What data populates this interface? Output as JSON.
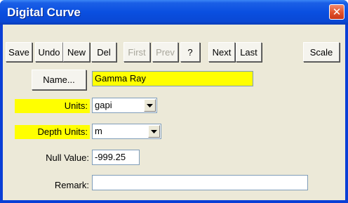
{
  "window": {
    "title": "Digital Curve",
    "close_glyph": "✕"
  },
  "toolbar": {
    "save": "Save",
    "undo": "Undo",
    "new": "New",
    "del": "Del",
    "first": "First",
    "prev": "Prev",
    "help": "?",
    "next": "Next",
    "last": "Last",
    "scale": "Scale"
  },
  "form": {
    "name_button": "Name...",
    "name_value": "Gamma Ray",
    "units_label": "Units:",
    "units_value": "gapi",
    "depth_units_label": "Depth Units:",
    "depth_units_value": "m",
    "null_label": "Null Value:",
    "null_value": "-999.25",
    "remark_label": "Remark:",
    "remark_value": ""
  },
  "colors": {
    "highlight": "#ffff00",
    "titlebar": "#0a4fe0",
    "client": "#ece9d8"
  }
}
